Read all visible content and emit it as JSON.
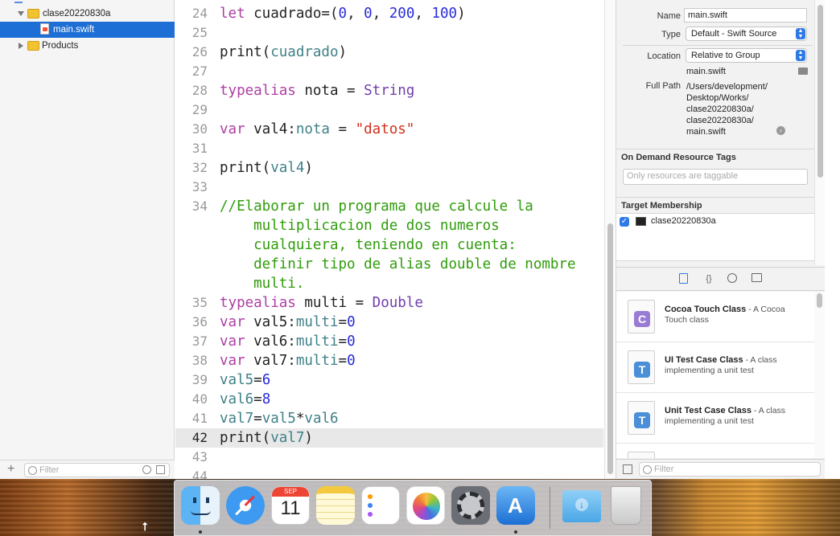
{
  "navigator": {
    "items": [
      {
        "label": "clase20220830a",
        "kind": "folder",
        "expanded": true
      },
      {
        "label": "main.swift",
        "kind": "swift-file",
        "selected": true
      },
      {
        "label": "Products",
        "kind": "folder",
        "expanded": false
      }
    ],
    "filter_placeholder": "Filter",
    "add_label": "+"
  },
  "editor": {
    "current_line": 42,
    "lines": [
      {
        "n": "24",
        "tokens": [
          [
            "kw",
            "let"
          ],
          [
            "pl",
            " cuadrado=("
          ],
          [
            "num",
            "0"
          ],
          [
            "pl",
            ", "
          ],
          [
            "num",
            "0"
          ],
          [
            "pl",
            ", "
          ],
          [
            "num",
            "200"
          ],
          [
            "pl",
            ", "
          ],
          [
            "num",
            "100"
          ],
          [
            "pl",
            ")"
          ]
        ]
      },
      {
        "n": "25",
        "tokens": []
      },
      {
        "n": "26",
        "tokens": [
          [
            "pl",
            "print("
          ],
          [
            "id",
            "cuadrado"
          ],
          [
            "pl",
            ")"
          ]
        ]
      },
      {
        "n": "27",
        "tokens": []
      },
      {
        "n": "28",
        "tokens": [
          [
            "kw",
            "typealias"
          ],
          [
            "pl",
            " nota = "
          ],
          [
            "ty",
            "String"
          ]
        ]
      },
      {
        "n": "29",
        "tokens": []
      },
      {
        "n": "30",
        "tokens": [
          [
            "kw",
            "var"
          ],
          [
            "pl",
            " val4:"
          ],
          [
            "id",
            "nota"
          ],
          [
            "pl",
            " = "
          ],
          [
            "str",
            "\"datos\""
          ]
        ]
      },
      {
        "n": "31",
        "tokens": []
      },
      {
        "n": "32",
        "tokens": [
          [
            "pl",
            "print("
          ],
          [
            "id",
            "val4"
          ],
          [
            "pl",
            ")"
          ]
        ]
      },
      {
        "n": "33",
        "tokens": []
      },
      {
        "n": "34",
        "tokens": [
          [
            "cm",
            "//Elaborar un programa que calcule la"
          ]
        ]
      },
      {
        "n": "",
        "tokens": [
          [
            "cm",
            "    multiplicacion de dos numeros"
          ]
        ]
      },
      {
        "n": "",
        "tokens": [
          [
            "cm",
            "    cualquiera, teniendo en cuenta:"
          ]
        ]
      },
      {
        "n": "",
        "tokens": [
          [
            "cm",
            "    definir tipo de alias double de nombre"
          ]
        ]
      },
      {
        "n": "",
        "tokens": [
          [
            "cm",
            "    multi."
          ]
        ]
      },
      {
        "n": "35",
        "tokens": [
          [
            "kw",
            "typealias"
          ],
          [
            "pl",
            " multi = "
          ],
          [
            "ty",
            "Double"
          ]
        ]
      },
      {
        "n": "36",
        "tokens": [
          [
            "kw",
            "var"
          ],
          [
            "pl",
            " val5:"
          ],
          [
            "id",
            "multi"
          ],
          [
            "pl",
            "="
          ],
          [
            "num",
            "0"
          ]
        ]
      },
      {
        "n": "37",
        "tokens": [
          [
            "kw",
            "var"
          ],
          [
            "pl",
            " val6:"
          ],
          [
            "id",
            "multi"
          ],
          [
            "pl",
            "="
          ],
          [
            "num",
            "0"
          ]
        ]
      },
      {
        "n": "38",
        "tokens": [
          [
            "kw",
            "var"
          ],
          [
            "pl",
            " val7:"
          ],
          [
            "id",
            "multi"
          ],
          [
            "pl",
            "="
          ],
          [
            "num",
            "0"
          ]
        ]
      },
      {
        "n": "39",
        "tokens": [
          [
            "id",
            "val5"
          ],
          [
            "pl",
            "="
          ],
          [
            "num",
            "6"
          ]
        ]
      },
      {
        "n": "40",
        "tokens": [
          [
            "id",
            "val6"
          ],
          [
            "pl",
            "="
          ],
          [
            "num",
            "8"
          ]
        ]
      },
      {
        "n": "41",
        "tokens": [
          [
            "id",
            "val7"
          ],
          [
            "pl",
            "="
          ],
          [
            "id",
            "val5"
          ],
          [
            "pl",
            "*"
          ],
          [
            "id",
            "val6"
          ]
        ]
      },
      {
        "n": "42",
        "tokens": [
          [
            "pl",
            "print("
          ],
          [
            "id",
            "val7"
          ],
          [
            "pl",
            ")"
          ]
        ]
      },
      {
        "n": "43",
        "tokens": []
      },
      {
        "n": "44",
        "tokens": []
      }
    ]
  },
  "inspector": {
    "name_label": "Name",
    "name_value": "main.swift",
    "type_label": "Type",
    "type_value": "Default - Swift Source",
    "location_label": "Location",
    "location_value": "Relative to Group",
    "location_file": "main.swift",
    "fullpath_label": "Full Path",
    "fullpath_lines": [
      "/Users/development/",
      "Desktop/Works/",
      "clase20220830a/",
      "clase20220830a/",
      "main.swift"
    ],
    "ondemand_title": "On Demand Resource Tags",
    "tags_placeholder": "Only resources are taggable",
    "target_title": "Target Membership",
    "target_name": "clase20220830a",
    "target_checked": true
  },
  "library": {
    "items": [
      {
        "title": "Cocoa Touch Class",
        "desc": " - A Cocoa Touch class",
        "badge": "C",
        "color": "#9a7bd4"
      },
      {
        "title": "UI Test Case Class",
        "desc": " - A class implementing a unit test",
        "badge": "T",
        "color": "#4a8fd8"
      },
      {
        "title": "Unit Test Case Class",
        "desc": " - A class implementing a unit test",
        "badge": "T",
        "color": "#4a8fd8"
      }
    ],
    "filter_placeholder": "Filter"
  },
  "dock": {
    "calendar_month": "SEP",
    "calendar_day": "11",
    "apps": [
      {
        "name": "finder-icon",
        "running": true
      },
      {
        "name": "safari-icon",
        "running": false
      },
      {
        "name": "calendar-icon",
        "running": false
      },
      {
        "name": "notes-icon",
        "running": false
      },
      {
        "name": "reminders-icon",
        "running": false
      },
      {
        "name": "photos-icon",
        "running": false
      },
      {
        "name": "system-preferences-icon",
        "running": false
      },
      {
        "name": "xcode-icon",
        "running": true
      },
      {
        "name": "downloads-folder-icon",
        "running": false
      },
      {
        "name": "trash-icon",
        "running": false
      }
    ]
  },
  "colors": {
    "keyword": "#ad3da4",
    "type": "#703daa",
    "number": "#272ad8",
    "string": "#d12f1b",
    "identifier": "#3e8087",
    "comment": "#2f9c0a",
    "selection": "#1d6fd6",
    "accent": "#2f7ae5"
  }
}
